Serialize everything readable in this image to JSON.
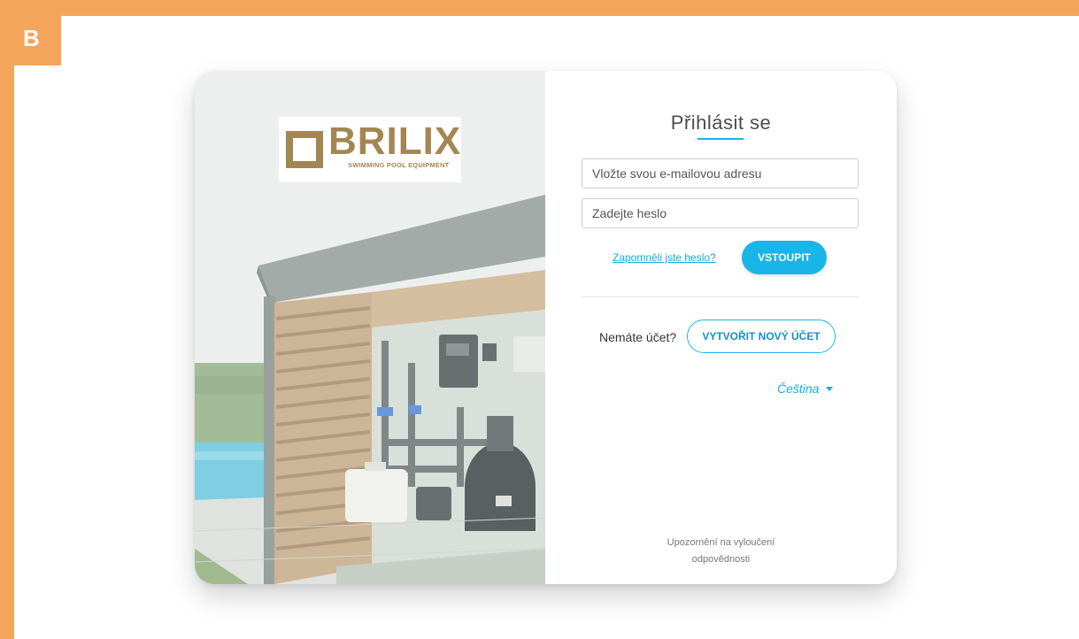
{
  "badge": {
    "label": "B"
  },
  "brand": {
    "name": "BRILIX",
    "tagline": "SWIMMING POOL EQUIPMENT"
  },
  "login": {
    "title": "Přihlásit se",
    "email_placeholder": "Vložte svou e-mailovou adresu",
    "password_placeholder": "Zadejte heslo",
    "forgot_link": "Zapomněli jste heslo?",
    "submit_label": "VSTOUPIT"
  },
  "register": {
    "prompt": "Nemáte účet?",
    "button_label": "VYTVOŘIT NOVÝ ÚČET"
  },
  "language": {
    "selected": "Čeština"
  },
  "footer": {
    "disclaimer_line1": "Upozornění na vyloučení",
    "disclaimer_line2": "odpovědnosti"
  },
  "colors": {
    "frame": "#f4a55c",
    "accent": "#19b4e8",
    "brand": "#a48653"
  }
}
